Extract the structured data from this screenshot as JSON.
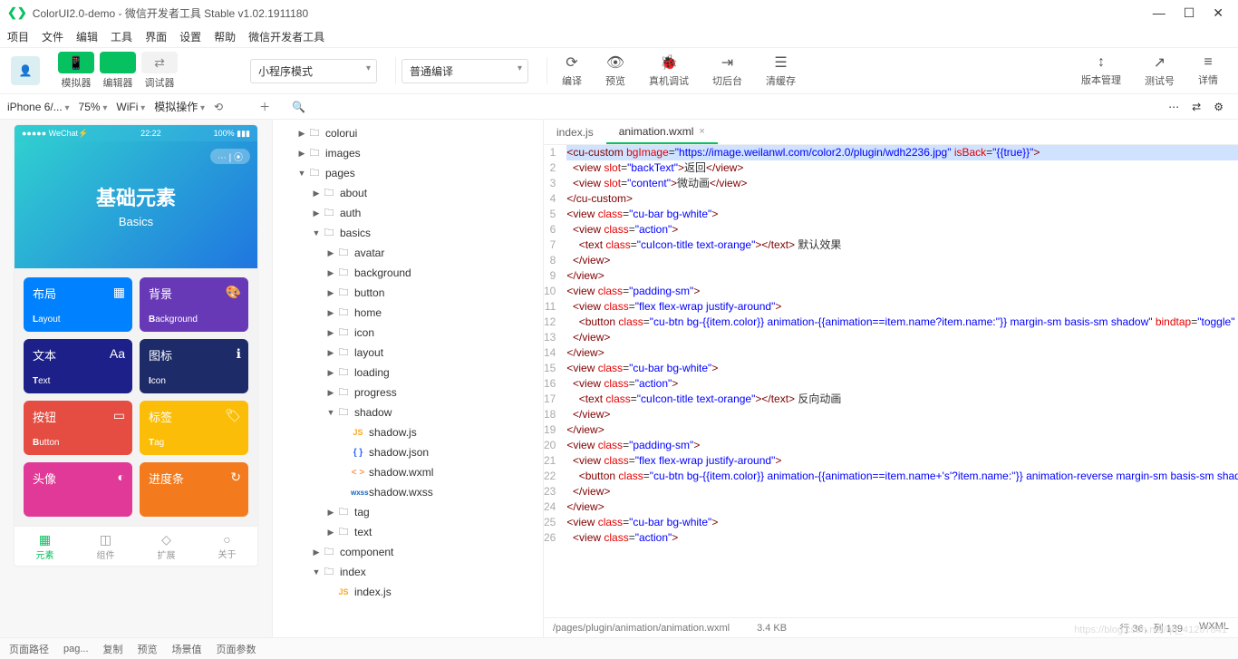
{
  "window": {
    "title": "ColorUI2.0-demo - 微信开发者工具 Stable v1.02.1911180"
  },
  "menubar": [
    "项目",
    "文件",
    "编辑",
    "工具",
    "界面",
    "设置",
    "帮助",
    "微信开发者工具"
  ],
  "topbar": {
    "modes": [
      {
        "icon": "📱",
        "label": "模拟器"
      },
      {
        "icon": "</>",
        "label": "编辑器"
      },
      {
        "icon": "⇄",
        "label": "调试器"
      }
    ],
    "program_mode": "小程序模式",
    "compile_mode": "普通编译",
    "actions": [
      {
        "icon": "⟳",
        "label": "编译"
      },
      {
        "icon": "👁",
        "label": "预览"
      },
      {
        "icon": "🐞",
        "label": "真机调试"
      },
      {
        "icon": "⇥",
        "label": "切后台"
      },
      {
        "icon": "☰",
        "label": "清缓存"
      }
    ],
    "right_actions": [
      {
        "icon": "↕",
        "label": "版本管理"
      },
      {
        "icon": "↗",
        "label": "测试号"
      },
      {
        "icon": "≡",
        "label": "详情"
      }
    ]
  },
  "subbar": {
    "device": "iPhone 6/...",
    "zoom": "75%",
    "network": "WiFi",
    "simop": "模拟操作"
  },
  "phone": {
    "status_left": "●●●●● WeChat⚡",
    "status_time": "22:22",
    "status_right": "100% ▮▮▮",
    "header_cn": "基础元素",
    "header_en": "Basics",
    "cards": [
      {
        "cn": "布局",
        "en": "Layout",
        "cls": "c-blue",
        "icon": "▦"
      },
      {
        "cn": "背景",
        "en": "Background",
        "cls": "c-purple",
        "icon": "🎨"
      },
      {
        "cn": "文本",
        "en": "Text",
        "cls": "c-dblue",
        "icon": "Aa"
      },
      {
        "cn": "图标",
        "en": "Icon",
        "cls": "c-navy",
        "icon": "ℹ"
      },
      {
        "cn": "按钮",
        "en": "Button",
        "cls": "c-pink",
        "icon": "▭"
      },
      {
        "cn": "标签",
        "en": "Tag",
        "cls": "c-yellow",
        "icon": "🏷"
      },
      {
        "cn": "头像",
        "en": "",
        "cls": "c-red",
        "icon": "◐"
      },
      {
        "cn": "进度条",
        "en": "",
        "cls": "c-orange",
        "icon": "↻"
      }
    ],
    "tabs": [
      {
        "icon": "▦",
        "label": "元素",
        "active": true
      },
      {
        "icon": "◫",
        "label": "组件"
      },
      {
        "icon": "◇",
        "label": "扩展"
      },
      {
        "icon": "○",
        "label": "关于"
      }
    ]
  },
  "tree": [
    {
      "d": 1,
      "t": "folder",
      "arrow": "▶",
      "name": "colorui"
    },
    {
      "d": 1,
      "t": "folder",
      "arrow": "▶",
      "name": "images"
    },
    {
      "d": 1,
      "t": "folder",
      "arrow": "▼",
      "name": "pages"
    },
    {
      "d": 2,
      "t": "folder",
      "arrow": "▶",
      "name": "about"
    },
    {
      "d": 2,
      "t": "folder",
      "arrow": "▶",
      "name": "auth"
    },
    {
      "d": 2,
      "t": "folder",
      "arrow": "▼",
      "name": "basics"
    },
    {
      "d": 3,
      "t": "folder",
      "arrow": "▶",
      "name": "avatar"
    },
    {
      "d": 3,
      "t": "folder",
      "arrow": "▶",
      "name": "background"
    },
    {
      "d": 3,
      "t": "folder",
      "arrow": "▶",
      "name": "button"
    },
    {
      "d": 3,
      "t": "folder",
      "arrow": "▶",
      "name": "home"
    },
    {
      "d": 3,
      "t": "folder",
      "arrow": "▶",
      "name": "icon"
    },
    {
      "d": 3,
      "t": "folder",
      "arrow": "▶",
      "name": "layout"
    },
    {
      "d": 3,
      "t": "folder",
      "arrow": "▶",
      "name": "loading"
    },
    {
      "d": 3,
      "t": "folder",
      "arrow": "▶",
      "name": "progress"
    },
    {
      "d": 3,
      "t": "folder",
      "arrow": "▼",
      "name": "shadow"
    },
    {
      "d": 4,
      "t": "js",
      "name": "shadow.js"
    },
    {
      "d": 4,
      "t": "json",
      "name": "shadow.json"
    },
    {
      "d": 4,
      "t": "wxml",
      "name": "shadow.wxml"
    },
    {
      "d": 4,
      "t": "wxss",
      "name": "shadow.wxss"
    },
    {
      "d": 3,
      "t": "folder",
      "arrow": "▶",
      "name": "tag"
    },
    {
      "d": 3,
      "t": "folder",
      "arrow": "▶",
      "name": "text"
    },
    {
      "d": 2,
      "t": "folder",
      "arrow": "▶",
      "name": "component"
    },
    {
      "d": 2,
      "t": "folder",
      "arrow": "▼",
      "name": "index"
    },
    {
      "d": 3,
      "t": "js",
      "name": "index.js"
    }
  ],
  "editor": {
    "tabs": [
      {
        "label": "index.js",
        "active": false
      },
      {
        "label": "animation.wxml",
        "active": true
      }
    ],
    "status_path": "/pages/plugin/animation/animation.wxml",
    "status_size": "3.4 KB",
    "status_pos": "行 36，列 139",
    "status_lang": "WXML",
    "lines": [
      {
        "n": 1,
        "sel": true,
        "h": "<span class='t-tag'>&lt;cu-custom</span> <span class='t-attr'>bgImage</span>=<span class='t-str'>\"https://image.weilanwl.com/color2.0/plugin/wdh2236.jpg\"</span> <span class='t-attr'>isBack</span>=<span class='t-str'>\"{{true}}\"</span><span class='t-tag'>&gt;</span>"
      },
      {
        "n": 2,
        "h": "  <span class='t-tag'>&lt;view</span> <span class='t-attr'>slot</span>=<span class='t-str'>\"backText\"</span><span class='t-tag'>&gt;</span>返回<span class='t-tag'>&lt;/view&gt;</span>"
      },
      {
        "n": 3,
        "h": "  <span class='t-tag'>&lt;view</span> <span class='t-attr'>slot</span>=<span class='t-str'>\"content\"</span><span class='t-tag'>&gt;</span>微动画<span class='t-tag'>&lt;/view&gt;</span>"
      },
      {
        "n": 4,
        "h": "<span class='t-tag'>&lt;/cu-custom&gt;</span>"
      },
      {
        "n": 5,
        "h": "<span class='t-tag'>&lt;view</span> <span class='t-attr'>class</span>=<span class='t-str'>\"cu-bar bg-white\"</span><span class='t-tag'>&gt;</span>"
      },
      {
        "n": 6,
        "h": "  <span class='t-tag'>&lt;view</span> <span class='t-attr'>class</span>=<span class='t-str'>\"action\"</span><span class='t-tag'>&gt;</span>"
      },
      {
        "n": 7,
        "h": "    <span class='t-tag'>&lt;text</span> <span class='t-attr'>class</span>=<span class='t-str'>\"cuIcon-title text-orange\"</span><span class='t-tag'>&gt;&lt;/text&gt;</span> 默认效果"
      },
      {
        "n": 8,
        "h": "  <span class='t-tag'>&lt;/view&gt;</span>"
      },
      {
        "n": 9,
        "h": "<span class='t-tag'>&lt;/view&gt;</span>"
      },
      {
        "n": 10,
        "h": "<span class='t-tag'>&lt;view</span> <span class='t-attr'>class</span>=<span class='t-str'>\"padding-sm\"</span><span class='t-tag'>&gt;</span>"
      },
      {
        "n": 11,
        "h": "  <span class='t-tag'>&lt;view</span> <span class='t-attr'>class</span>=<span class='t-str'>\"flex flex-wrap justify-around\"</span><span class='t-tag'>&gt;</span>"
      },
      {
        "n": 12,
        "h": "    <span class='t-tag'>&lt;button</span> <span class='t-attr'>class</span>=<span class='t-str'>\"cu-btn bg-{{item.color}} animation-{{animation==item.name?item.name:''}} margin-sm basis-sm shadow\"</span> <span class='t-attr'>bindtap</span>=<span class='t-str'>\"toggle\"</span> <span class='t-attr'>data-class</span>=<span class='t-str'>\"{{item.name}}\"</span> <span class='t-attr'>wx:for</span>=<span class='t-str'>\"{{list}}\"</span> <span class='t-attr'>wx:key</span>=<span class='t-str'>\"{{index}}\"</span><span class='t-tag'>&gt;</span>{{item.name}}<span class='t-tag'>&lt;/button&gt;</span>"
      },
      {
        "n": 13,
        "h": "  <span class='t-tag'>&lt;/view&gt;</span>"
      },
      {
        "n": 14,
        "h": "<span class='t-tag'>&lt;/view&gt;</span>"
      },
      {
        "n": 15,
        "h": "<span class='t-tag'>&lt;view</span> <span class='t-attr'>class</span>=<span class='t-str'>\"cu-bar bg-white\"</span><span class='t-tag'>&gt;</span>"
      },
      {
        "n": 16,
        "h": "  <span class='t-tag'>&lt;view</span> <span class='t-attr'>class</span>=<span class='t-str'>\"action\"</span><span class='t-tag'>&gt;</span>"
      },
      {
        "n": 17,
        "h": "    <span class='t-tag'>&lt;text</span> <span class='t-attr'>class</span>=<span class='t-str'>\"cuIcon-title text-orange\"</span><span class='t-tag'>&gt;&lt;/text&gt;</span> 反向动画"
      },
      {
        "n": 18,
        "h": "  <span class='t-tag'>&lt;/view&gt;</span>"
      },
      {
        "n": 19,
        "h": "<span class='t-tag'>&lt;/view&gt;</span>"
      },
      {
        "n": 20,
        "h": "<span class='t-tag'>&lt;view</span> <span class='t-attr'>class</span>=<span class='t-str'>\"padding-sm\"</span><span class='t-tag'>&gt;</span>"
      },
      {
        "n": 21,
        "h": "  <span class='t-tag'>&lt;view</span> <span class='t-attr'>class</span>=<span class='t-str'>\"flex flex-wrap justify-around\"</span><span class='t-tag'>&gt;</span>"
      },
      {
        "n": 22,
        "h": "    <span class='t-tag'>&lt;button</span> <span class='t-attr'>class</span>=<span class='t-str'>\"cu-btn bg-{{item.color}} animation-{{animation==item.name+'s'?item.name:''}} animation-reverse margin-sm basis-sm shadow\"</span> <span class='t-attr'>bindtap</span>=<span class='t-str'>\"toggle\"</span> <span class='t-attr'>data-class</span>=<span class='t-str'>\"{{item.name+'s'}}\"</span> <span class='t-attr'>wx:for</span>=<span class='t-str'>\"{{list}}\"</span> <span class='t-attr'>wx:key</span>=<span class='t-str'>\"{{index}}\"</span><span class='t-tag'>&gt;</span>{{item.name}}<span class='t-tag'>&lt;/button&gt;</span>"
      },
      {
        "n": 23,
        "h": "  <span class='t-tag'>&lt;/view&gt;</span>"
      },
      {
        "n": 24,
        "h": "<span class='t-tag'>&lt;/view&gt;</span>"
      },
      {
        "n": 25,
        "h": "<span class='t-tag'>&lt;view</span> <span class='t-attr'>class</span>=<span class='t-str'>\"cu-bar bg-white\"</span><span class='t-tag'>&gt;</span>"
      },
      {
        "n": 26,
        "h": "  <span class='t-tag'>&lt;view</span> <span class='t-attr'>class</span>=<span class='t-str'>\"action\"</span><span class='t-tag'>&gt;</span>"
      }
    ]
  },
  "bottombar": {
    "items": [
      "页面路径",
      "pag...",
      "复制",
      "预览",
      "场景值",
      "页面参数"
    ]
  },
  "watermark": "https://blog.csdn.net/qq_41207841"
}
